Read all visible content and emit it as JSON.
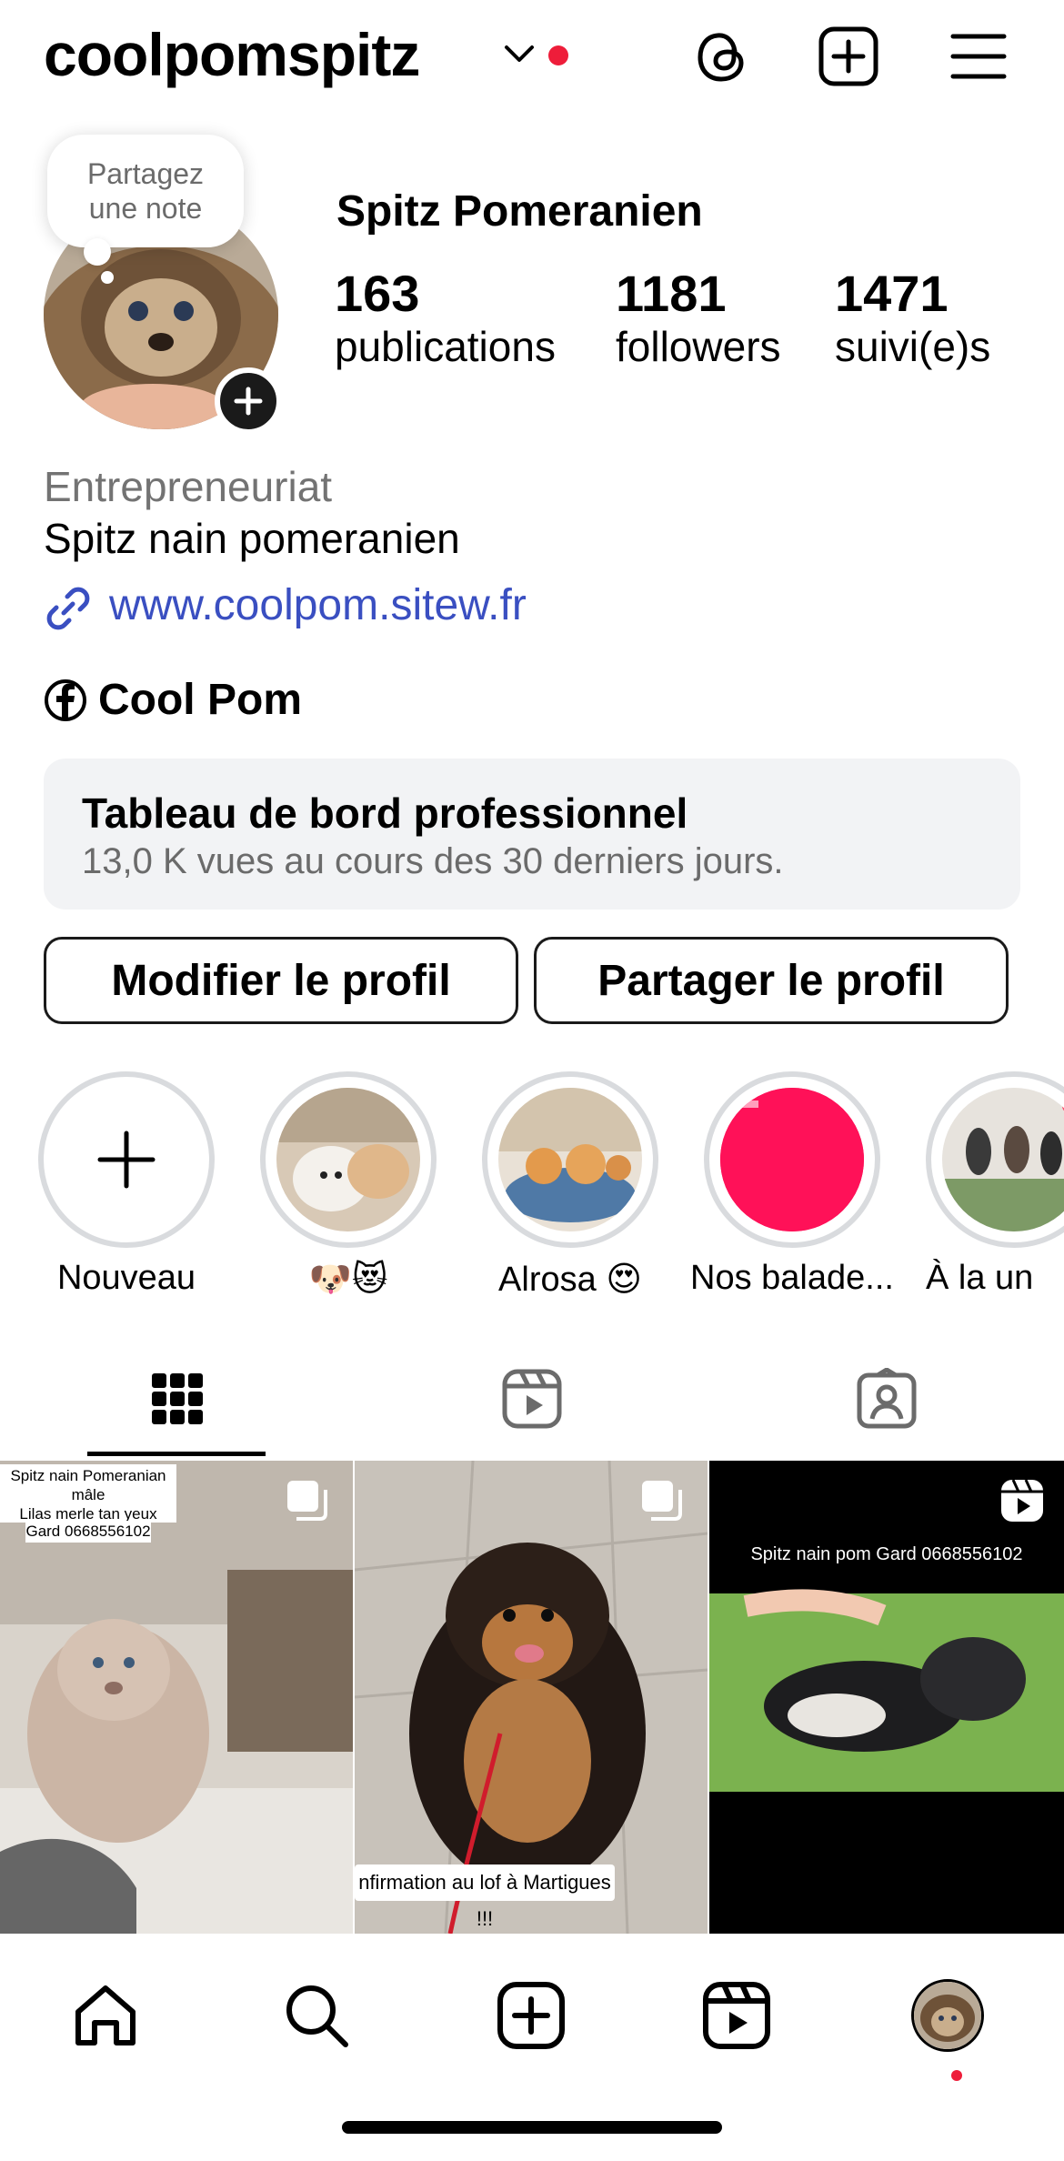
{
  "header": {
    "username": "coolpomspitz",
    "icons": [
      "chevron-down-icon",
      "threads-icon",
      "create-icon",
      "menu-icon"
    ],
    "live_dot_color": "#ee1d3a"
  },
  "profile": {
    "note_line1": "Partagez",
    "note_line2": "une note",
    "full_name": "Spitz Pomeranien",
    "stats": {
      "posts": {
        "count": "163",
        "label": "publications"
      },
      "followers": {
        "count": "1181",
        "label": "followers"
      },
      "following": {
        "count": "1471",
        "label": "suivi(e)s"
      }
    },
    "category": "Entrepreneuriat",
    "bio": "Spitz nain pomeranien",
    "link": "www.coolpom.sitew.fr",
    "facebook": "Cool Pom"
  },
  "dashboard": {
    "title": "Tableau de bord professionnel",
    "subtitle": "13,0 K vues au cours des 30 derniers jours."
  },
  "buttons": {
    "edit": "Modifier le profil",
    "share": "Partager le profil"
  },
  "highlights": [
    {
      "label": "Nouveau"
    },
    {
      "label": "🐶😻"
    },
    {
      "label": "Alrosa 😍"
    },
    {
      "label": "Nos balade..."
    },
    {
      "label": "À la un"
    }
  ],
  "tabs": [
    "grid-icon",
    "reels-icon",
    "tagged-icon"
  ],
  "posts": [
    {
      "overlay_line1": "Spitz nain Pomeranian mâle",
      "overlay_line2": "Lilas merle tan yeux bleus",
      "overlay_line3": "Gard 0668556102"
    },
    {
      "overlay": "nfirmation au lof à Martigues !!!"
    },
    {
      "overlay": "Spitz nain pom Gard 0668556102"
    }
  ],
  "bottom_nav": [
    "home-icon",
    "search-icon",
    "create-icon",
    "reels-icon",
    "profile-avatar"
  ],
  "link_color": "#3a4fc1",
  "highlight_fill_color": "#ff1158"
}
